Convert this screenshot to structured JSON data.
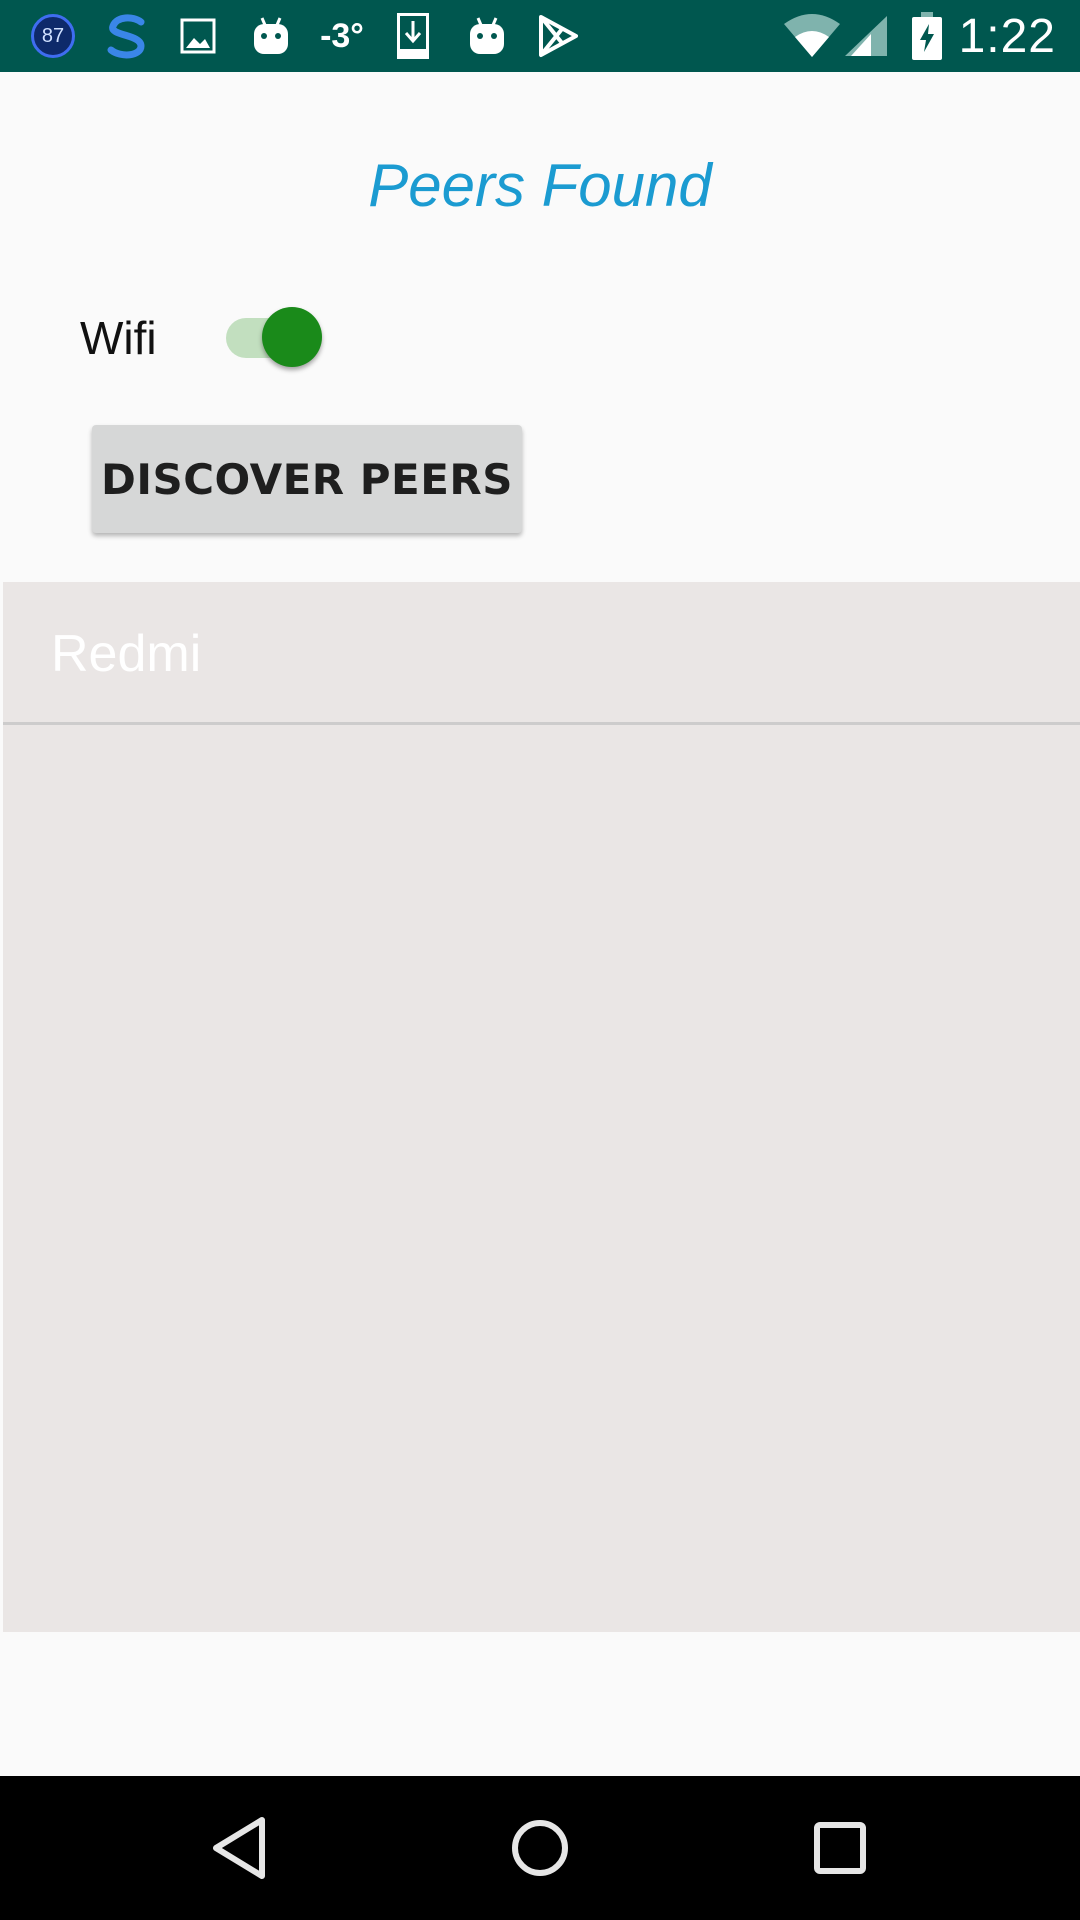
{
  "status_bar": {
    "notification_badge": "87",
    "temperature": "-3°",
    "time": "1:22",
    "background_color": "#00574f",
    "icons": [
      "counter-badge-icon",
      "s-app-icon",
      "image-icon",
      "android-icon",
      "download-icon",
      "android-icon",
      "play-store-icon",
      "wifi-icon",
      "signal-icon",
      "battery-charging-icon"
    ]
  },
  "main": {
    "title": "Peers Found",
    "title_color": "#1b9bd1",
    "wifi_label": "Wifi",
    "wifi_toggle_on": true,
    "discover_button_label": "DISCOVER PEERS",
    "peers": [
      {
        "name": "Redmi"
      }
    ]
  },
  "nav_bar": {
    "icons": [
      "back-icon",
      "home-icon",
      "recents-icon"
    ]
  }
}
